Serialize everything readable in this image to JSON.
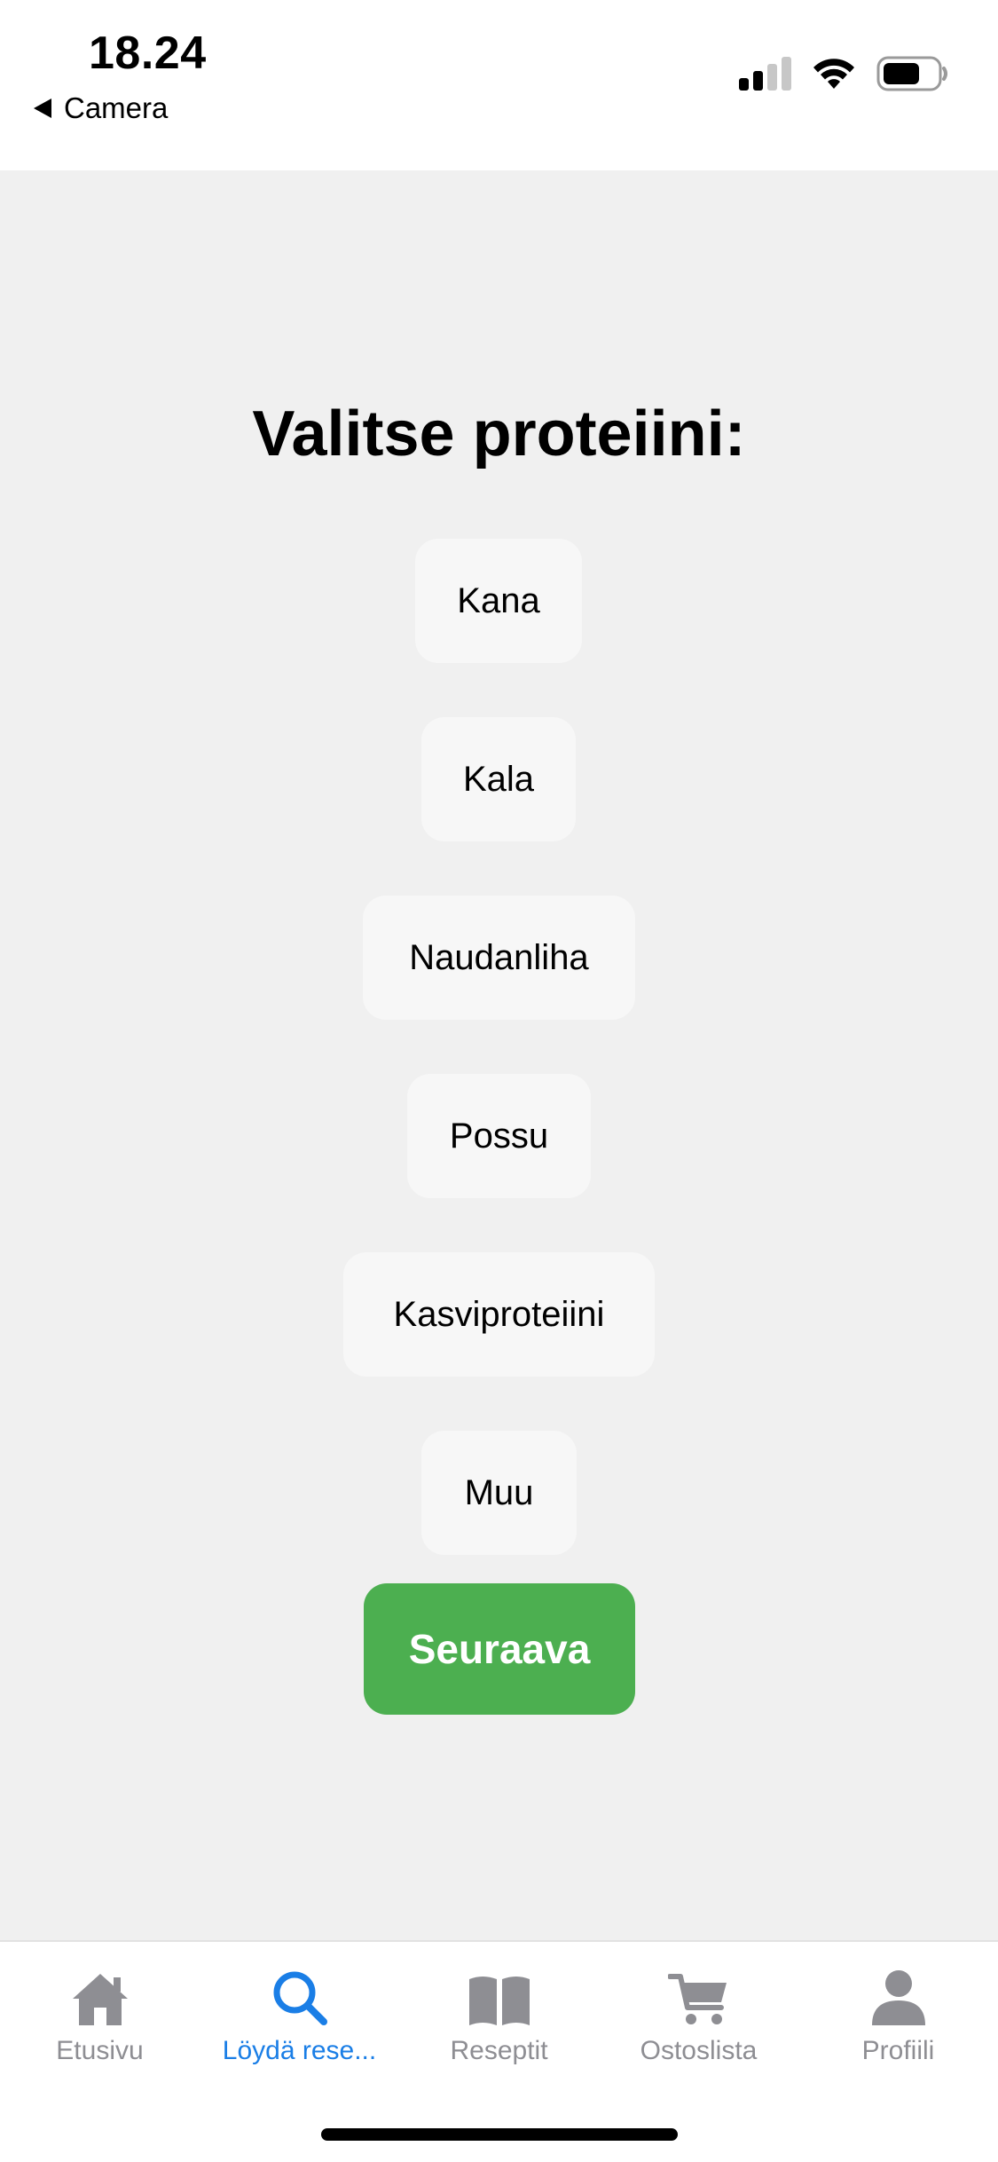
{
  "status_bar": {
    "time": "18.24",
    "back_label": "Camera"
  },
  "main": {
    "title": "Valitse proteiini:",
    "options": [
      {
        "label": "Kana"
      },
      {
        "label": "Kala"
      },
      {
        "label": "Naudanliha"
      },
      {
        "label": "Possu"
      },
      {
        "label": "Kasviproteiini"
      },
      {
        "label": "Muu"
      }
    ],
    "next_label": "Seuraava"
  },
  "tab_bar": {
    "tabs": [
      {
        "label": "Etusivu",
        "icon": "home-icon",
        "active": false
      },
      {
        "label": "Löydä rese...",
        "icon": "search-icon",
        "active": true
      },
      {
        "label": "Reseptit",
        "icon": "book-icon",
        "active": false
      },
      {
        "label": "Ostoslista",
        "icon": "cart-icon",
        "active": false
      },
      {
        "label": "Profiili",
        "icon": "person-icon",
        "active": false
      }
    ]
  },
  "colors": {
    "accent": "#1a7ee6",
    "next_button": "#4caf50",
    "background": "#f0f0f0",
    "inactive_tab": "#8e8e93"
  }
}
